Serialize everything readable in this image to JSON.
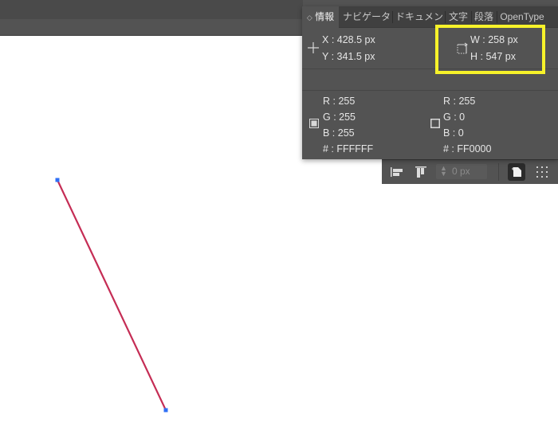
{
  "info_panel": {
    "tabs": [
      {
        "label": "情報",
        "active": true,
        "collapse_glyph": "◇"
      },
      {
        "label": "ナビゲータ",
        "active": false
      },
      {
        "label": "ドキュメン",
        "active": false
      },
      {
        "label": "文字",
        "active": false
      },
      {
        "label": "段落",
        "active": false
      },
      {
        "label": "OpenType",
        "active": false
      }
    ],
    "position": {
      "x_label": "X",
      "x_value": "428.5 px",
      "y_label": "Y",
      "y_value": "341.5 px"
    },
    "size": {
      "w_label": "W",
      "w_value": "258 px",
      "h_label": "H",
      "h_value": "547 px"
    },
    "fill": {
      "r": "R : 255",
      "g": "G : 255",
      "b": "B : 255",
      "hex": "# : FFFFFF"
    },
    "stroke": {
      "r": "R : 255",
      "g": "G : 0",
      "b": "B : 0",
      "hex": "# : FF0000"
    }
  },
  "toolbar": {
    "stroke_value": "0 px"
  },
  "canvas": {
    "line_color": "#c52d55",
    "anchor_color": "#2f6ff5"
  },
  "colors": {
    "panel_bg": "#535353",
    "tab_bg": "#404040",
    "highlight": "#f7f22a"
  }
}
